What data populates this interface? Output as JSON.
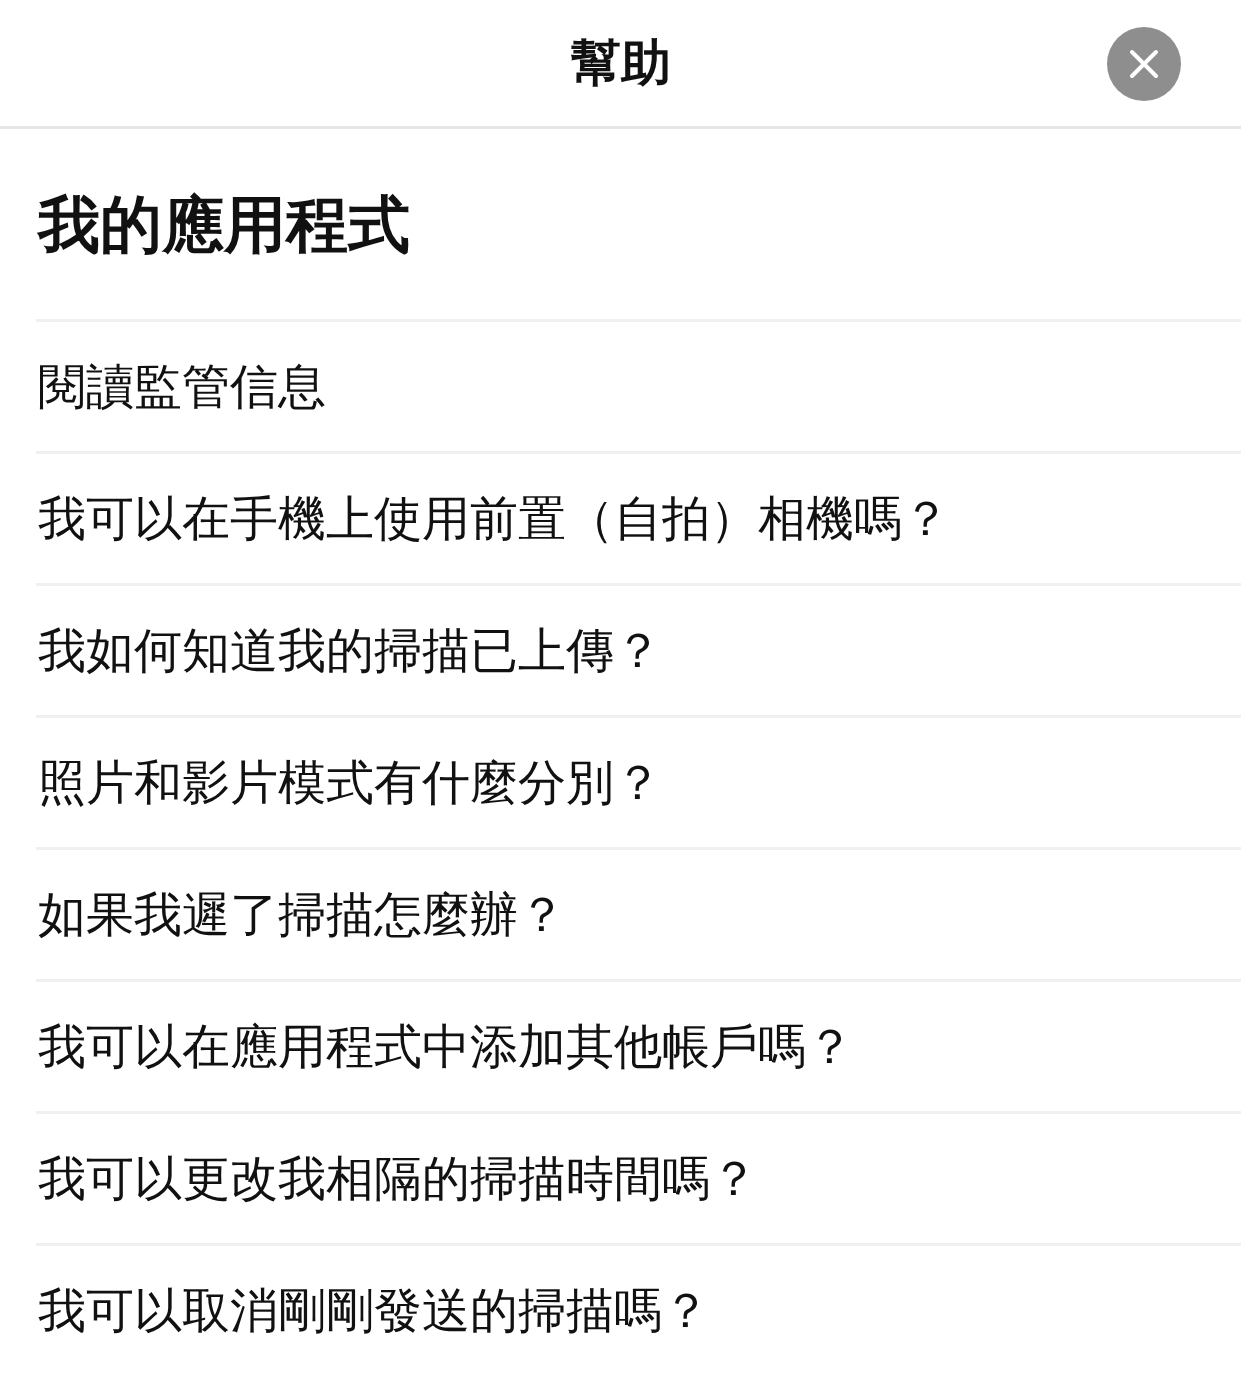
{
  "header": {
    "title": "幫助"
  },
  "section": {
    "title": "我的應用程式",
    "items": [
      "閱讀監管信息",
      "我可以在手機上使用前置（自拍）相機嗎？",
      "我如何知道我的掃描已上傳？",
      "照片和影片模式有什麼分別？",
      "如果我遲了掃描怎麼辦？",
      "我可以在應用程式中添加其他帳戶嗎？",
      "我可以更改我相隔的掃描時間嗎？",
      "我可以取消剛剛發送的掃描嗎？"
    ]
  }
}
